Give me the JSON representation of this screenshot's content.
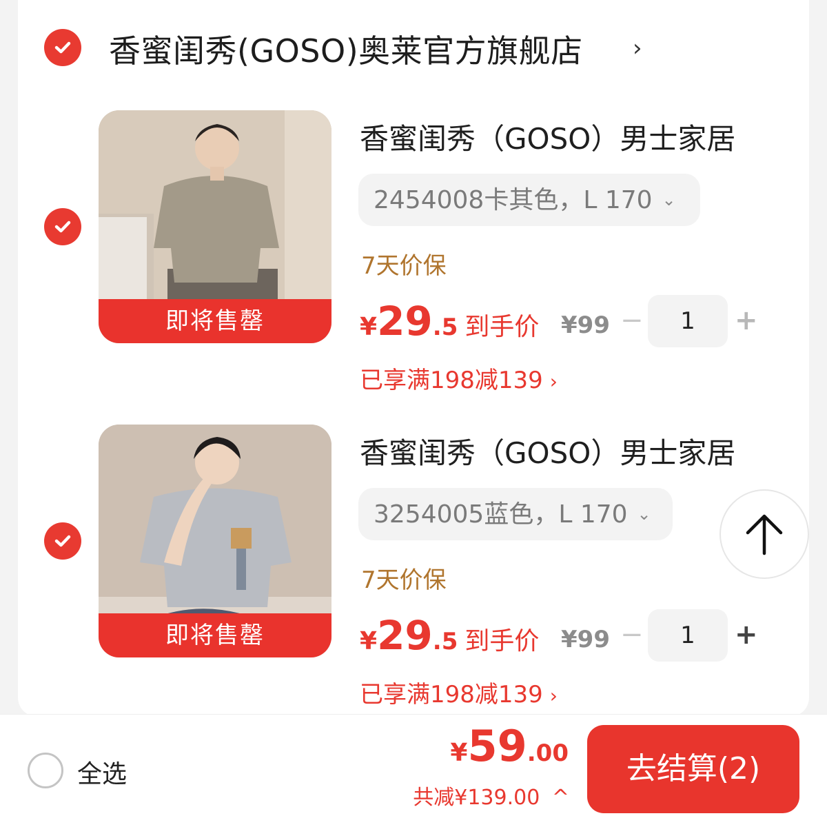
{
  "shop": {
    "name": "香蜜闺秀(GOSO)奥莱官方旗舰店",
    "chevron": "›"
  },
  "items": [
    {
      "name": "香蜜闺秀（GOSO）男士家居",
      "spec": "2454008卡其色，L 170",
      "spec_chevron": "⌄",
      "guarantee": "7天价保",
      "banner": "即将售罄",
      "price_symbol": "¥",
      "price_int": "29",
      "price_dec": ".5",
      "price_label": "到手价",
      "original_price": "¥99",
      "minus": "−",
      "quantity": "1",
      "plus": "+",
      "promo": "已享满198减139",
      "promo_chevron": "›",
      "shirt_color": "#a39a89"
    },
    {
      "name": "香蜜闺秀（GOSO）男士家居",
      "spec": "3254005蓝色，L 170",
      "spec_chevron": "⌄",
      "guarantee": "7天价保",
      "banner": "即将售罄",
      "price_symbol": "¥",
      "price_int": "29",
      "price_dec": ".5",
      "price_label": "到手价",
      "original_price": "¥99",
      "minus": "−",
      "quantity": "1",
      "plus": "+",
      "promo": "已享满198减139",
      "promo_chevron": "›",
      "shirt_color": "#b9bcc2"
    }
  ],
  "footer": {
    "select_all": "全选",
    "total_symbol": "¥",
    "total_int": "59",
    "total_dec": ".00",
    "saving": "共减¥139.00",
    "saving_chevron": "^",
    "checkout": "去结算(2)"
  },
  "colors": {
    "accent": "#e8382f",
    "guarantee": "#b0752e"
  },
  "icons": {
    "check": "check-icon",
    "back_to_top": "arrow-up-icon"
  }
}
